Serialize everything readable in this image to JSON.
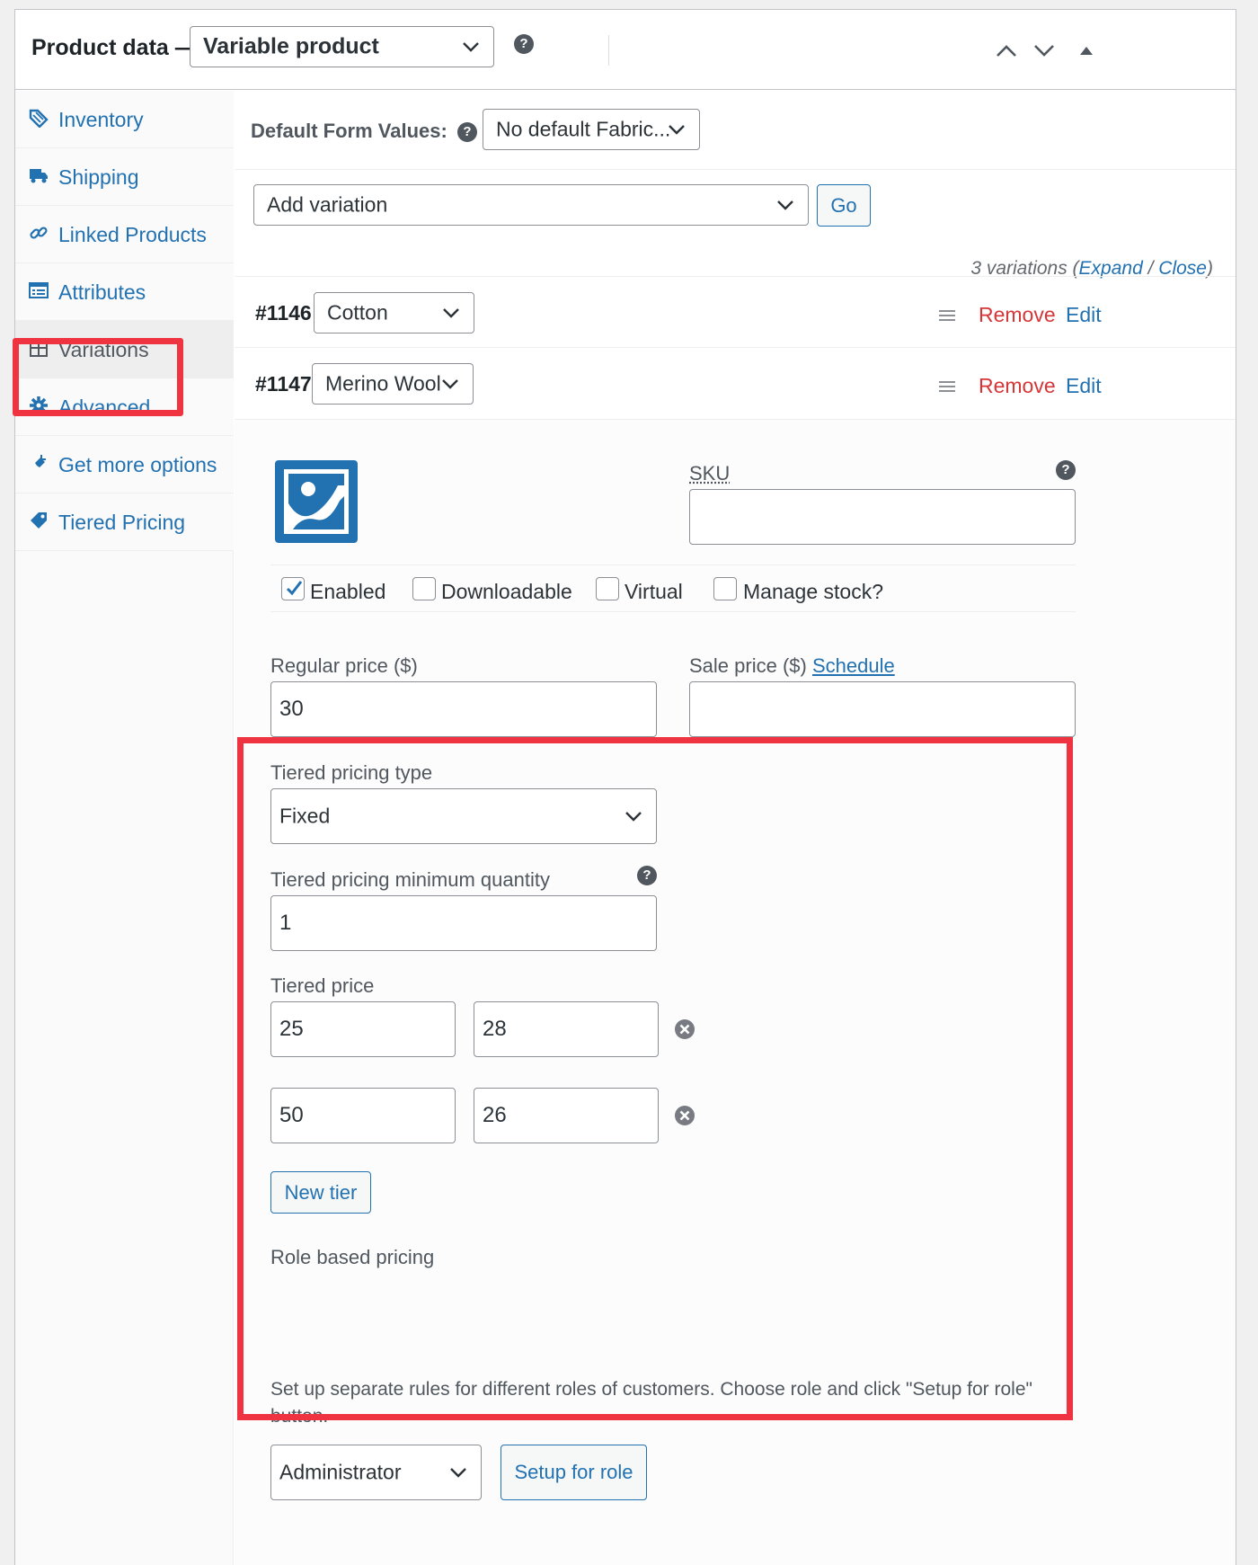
{
  "header": {
    "title": "Product data —",
    "product_type": "Variable product"
  },
  "tabs": [
    {
      "label": "Inventory",
      "icon": "tag-icon"
    },
    {
      "label": "Shipping",
      "icon": "truck-icon"
    },
    {
      "label": "Linked Products",
      "icon": "link-icon"
    },
    {
      "label": "Attributes",
      "icon": "list-icon"
    },
    {
      "label": "Variations",
      "icon": "grid-icon",
      "active": true
    },
    {
      "label": "Advanced",
      "icon": "gear-icon"
    },
    {
      "label": "Get more options",
      "icon": "plugin-icon"
    },
    {
      "label": "Tiered Pricing",
      "icon": "price-tag-icon"
    }
  ],
  "default_form": {
    "label": "Default Form Values:",
    "value": "No default Fabric..."
  },
  "add_variation": {
    "value": "Add variation",
    "go": "Go"
  },
  "count": {
    "text": "3 variations (",
    "expand": "Expand",
    "sep": " / ",
    "close": "Close",
    "end": ")"
  },
  "variations": [
    {
      "id": "#1146",
      "attribute": "Cotton",
      "remove": "Remove",
      "edit": "Edit"
    },
    {
      "id": "#1147",
      "attribute": "Merino Wool",
      "remove": "Remove",
      "edit": "Edit"
    }
  ],
  "variation_detail": {
    "sku_label": "SKU",
    "sku_value": "",
    "checkboxes": [
      {
        "label": "Enabled",
        "checked": true
      },
      {
        "label": "Downloadable",
        "checked": false
      },
      {
        "label": "Virtual",
        "checked": false
      },
      {
        "label": "Manage stock?",
        "checked": false
      }
    ],
    "regular_price_label": "Regular price ($)",
    "regular_price": "30",
    "sale_price_label": "Sale price ($)",
    "schedule": "Schedule",
    "sale_price": ""
  },
  "tiered": {
    "type_label": "Tiered pricing type",
    "type_value": "Fixed",
    "min_qty_label": "Tiered pricing minimum quantity",
    "min_qty": "1",
    "price_label": "Tiered price",
    "tiers": [
      {
        "qty": "25",
        "price": "28"
      },
      {
        "qty": "50",
        "price": "26"
      }
    ],
    "new_tier": "New tier",
    "role_label": "Role based pricing",
    "role_desc": "Set up separate rules for different roles of customers. Choose role and click \"Setup for role\" button.",
    "role_value": "Administrator",
    "setup_button": "Setup for role"
  },
  "colors": {
    "highlight": "#ef3340",
    "link": "#2271b1",
    "remove": "#d63638"
  }
}
